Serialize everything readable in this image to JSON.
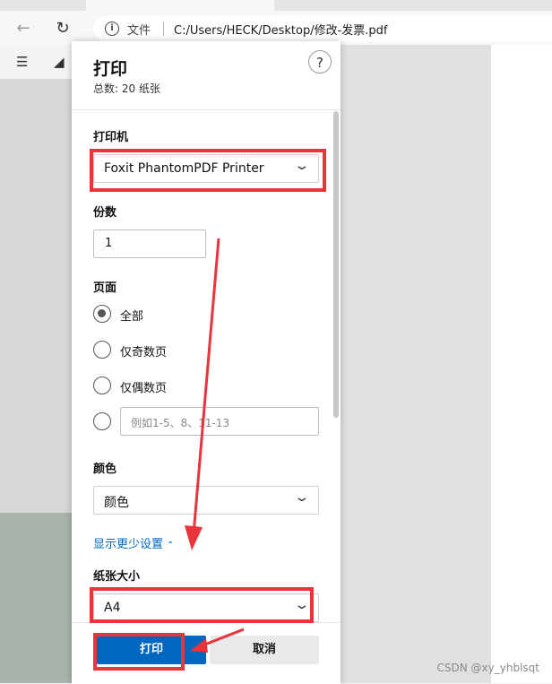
{
  "browser": {
    "file_label": "文件",
    "url": "C:/Users/HECK/Desktop/修改-发票.pdf"
  },
  "dialog": {
    "title": "打印",
    "subtitle": "总数: 20 纸张",
    "help": "?",
    "printer": {
      "label": "打印机",
      "value": "Foxit PhantomPDF Printer"
    },
    "copies": {
      "label": "份数",
      "value": "1"
    },
    "pages": {
      "label": "页面",
      "options": [
        "全部",
        "仅奇数页",
        "仅偶数页"
      ],
      "custom_placeholder": "例如1-5、8、11-13"
    },
    "color": {
      "label": "颜色",
      "value": "颜色"
    },
    "more_settings": "显示更少设置",
    "paper": {
      "label": "纸张大小",
      "value": "A4"
    },
    "print_button": "打印",
    "cancel_button": "取消"
  },
  "watermark": "CSDN @xy_yhblsqt",
  "colors": {
    "accent": "#0067c0",
    "annotation": "#e8343a"
  }
}
